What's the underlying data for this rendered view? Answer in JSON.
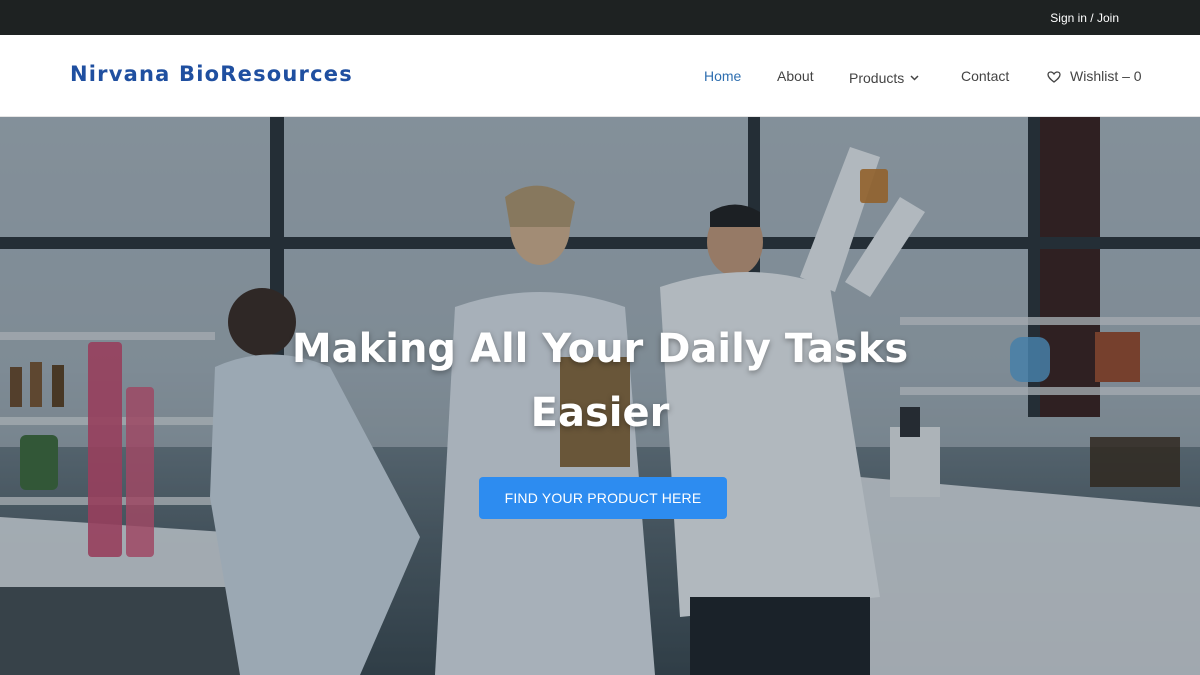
{
  "topbar": {
    "signin_label": "Sign in / Join"
  },
  "header": {
    "brand": "Nirvana BioResources",
    "nav": {
      "home": "Home",
      "about": "About",
      "products": "Products",
      "contact": "Contact",
      "wishlist": "Wishlist – 0"
    },
    "icons": {
      "products_dropdown": "chevron-down-icon",
      "wishlist": "heart-icon"
    }
  },
  "hero": {
    "headline_line1": "Making All Your Daily Tasks",
    "headline_line2": "Easier",
    "cta_label": "FIND YOUR PRODUCT HERE"
  },
  "colors": {
    "topbar_bg": "#1e2222",
    "brand": "#1f4fa0",
    "nav_active": "#2f6fb0",
    "cta_bg": "#2d8cf0"
  }
}
